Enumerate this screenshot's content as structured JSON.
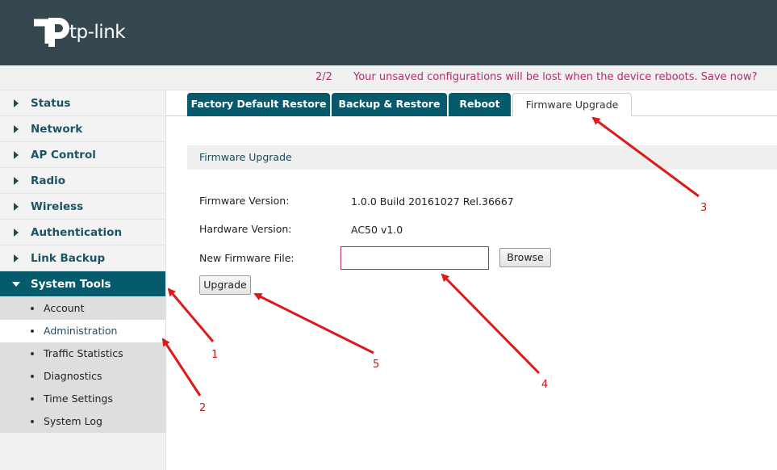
{
  "brand": {
    "name": "tp-link"
  },
  "notice": {
    "count": "2/2",
    "message": "Your unsaved configurations will be lost when the device reboots. Save now?"
  },
  "sidebar": {
    "items": [
      {
        "label": "Status"
      },
      {
        "label": "Network"
      },
      {
        "label": "AP Control"
      },
      {
        "label": "Radio"
      },
      {
        "label": "Wireless"
      },
      {
        "label": "Authentication"
      },
      {
        "label": "Link Backup"
      },
      {
        "label": "System Tools"
      }
    ],
    "subitems": [
      {
        "label": "Account"
      },
      {
        "label": "Administration"
      },
      {
        "label": "Traffic Statistics"
      },
      {
        "label": "Diagnostics"
      },
      {
        "label": "Time Settings"
      },
      {
        "label": "System Log"
      }
    ]
  },
  "tabs": [
    {
      "label": "Factory Default Restore"
    },
    {
      "label": "Backup & Restore"
    },
    {
      "label": "Reboot"
    },
    {
      "label": "Firmware Upgrade"
    }
  ],
  "section": {
    "title": "Firmware Upgrade"
  },
  "fields": {
    "firmware_label": "Firmware Version:",
    "firmware_value": "1.0.0 Build 20161027 Rel.36667",
    "hardware_label": "Hardware Version:",
    "hardware_value": "AC50 v1.0",
    "file_label": "New Firmware File:",
    "file_value": ""
  },
  "buttons": {
    "browse": "Browse",
    "upgrade": "Upgrade"
  },
  "annotations": [
    "1",
    "2",
    "3",
    "4",
    "5"
  ],
  "colors": {
    "header": "#37474f",
    "accent": "#055b6c",
    "notice": "#b0306a",
    "annotation": "#c41a1a"
  }
}
